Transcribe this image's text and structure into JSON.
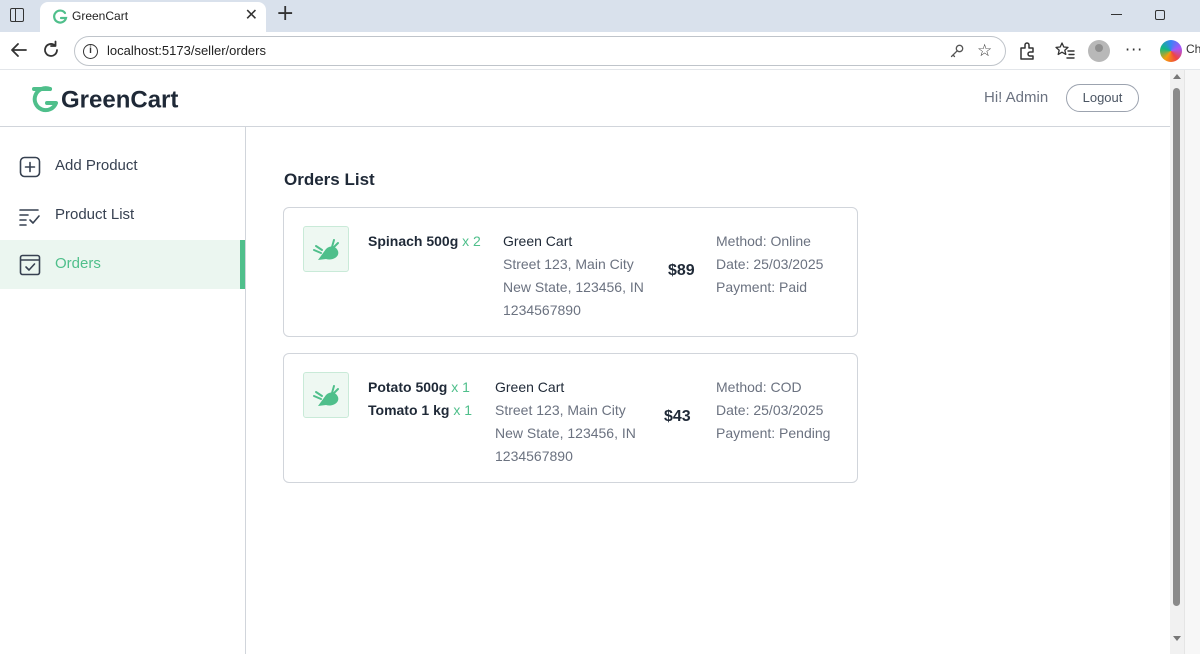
{
  "browser": {
    "tab_title": "GreenCart",
    "url": "localhost:5173/seller/orders",
    "copilot_label": "Ch"
  },
  "header": {
    "logo_text": "GreenCart",
    "greeting": "Hi! Admin",
    "logout_label": "Logout"
  },
  "sidebar": {
    "items": [
      {
        "label": "Add Product",
        "icon": "add-box-icon",
        "active": false
      },
      {
        "label": "Product List",
        "icon": "list-check-icon",
        "active": false
      },
      {
        "label": "Orders",
        "icon": "order-check-icon",
        "active": true
      }
    ]
  },
  "main": {
    "title": "Orders List",
    "orders": [
      {
        "items": [
          {
            "name": "Spinach 500g",
            "qty": "x 2"
          }
        ],
        "address": {
          "name": "Green Cart",
          "line1": "Street 123, Main City",
          "line2": "New State, 123456, IN",
          "phone": "1234567890"
        },
        "amount": "$89",
        "method": "Method: Online",
        "date": "Date: 25/03/2025",
        "payment": "Payment: Paid"
      },
      {
        "items": [
          {
            "name": "Potato 500g",
            "qty": "x 1"
          },
          {
            "name": "Tomato 1 kg",
            "qty": "x 1"
          }
        ],
        "address": {
          "name": "Green Cart",
          "line1": "Street 123, Main City",
          "line2": "New State, 123456, IN",
          "phone": "1234567890"
        },
        "amount": "$43",
        "method": "Method: COD",
        "date": "Date: 25/03/2025",
        "payment": "Payment: Pending"
      }
    ]
  },
  "colors": {
    "accent": "#4fbf8b",
    "active_bg": "#ebf6f0",
    "text_dark": "#1f2937",
    "text_muted": "#6b7280"
  }
}
